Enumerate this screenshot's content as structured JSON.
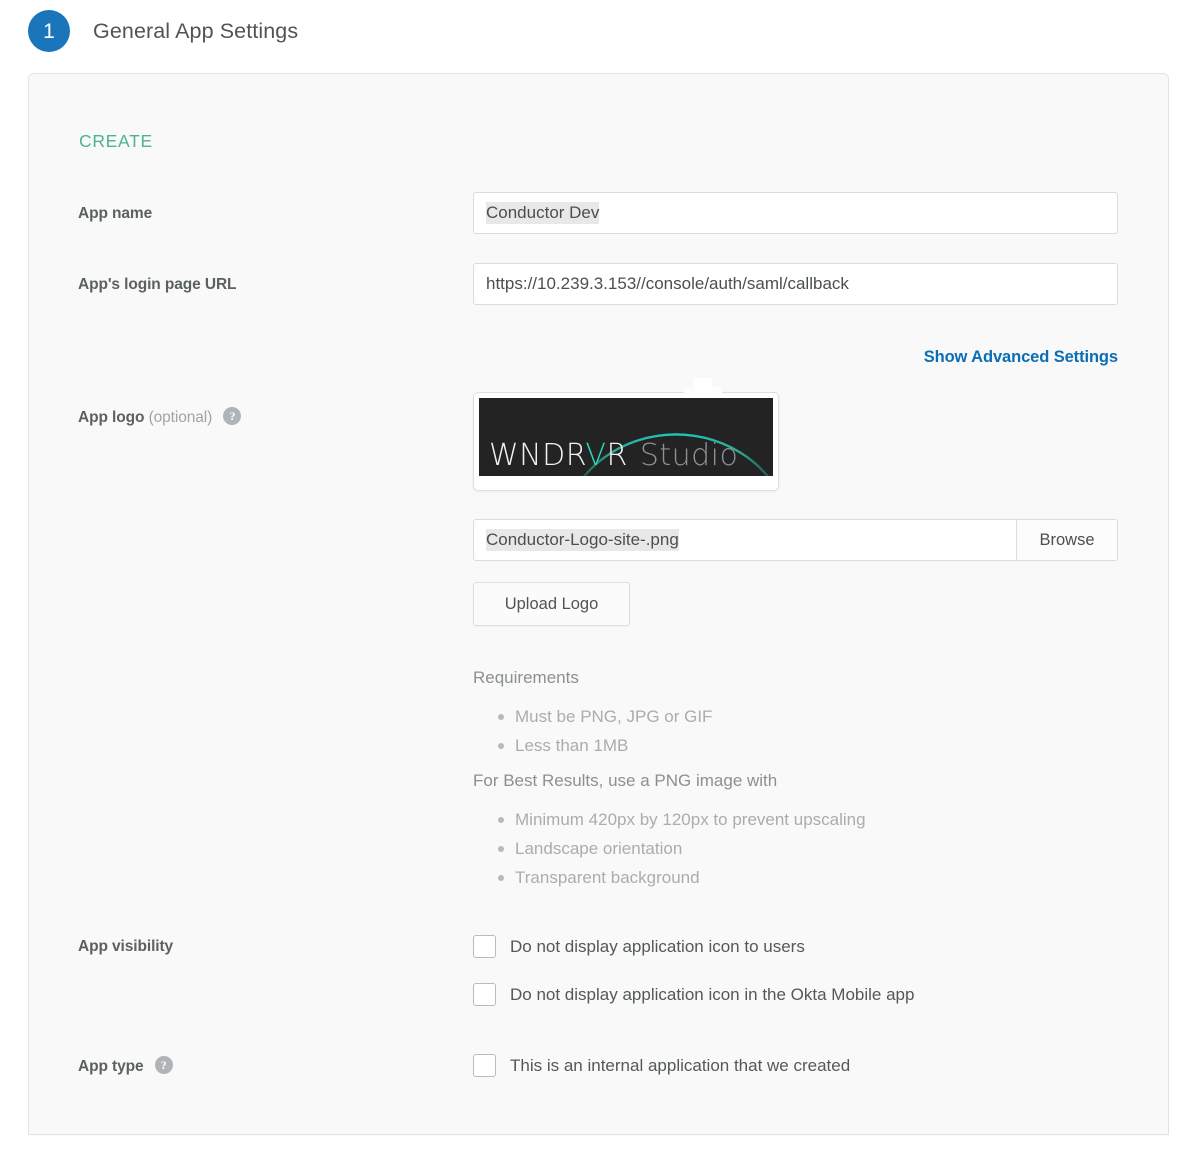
{
  "step": {
    "number": "1",
    "title": "General App Settings",
    "badge_color": "#1a75bb"
  },
  "panel": {
    "section_label": "CREATE",
    "section_label_color": "#4cb58c"
  },
  "fields": {
    "app_name": {
      "label": "App name",
      "value": "Conductor Dev"
    },
    "login_url": {
      "label": "App's login page URL",
      "value": "https://10.239.3.153//console/auth/saml/callback"
    },
    "advanced_link": {
      "label": "Show Advanced Settings",
      "color": "#0a6db5"
    },
    "app_logo": {
      "label": "App logo",
      "optional_text": "(optional)",
      "help_glyph": "?",
      "preview_alt": "WNDRVR Studio logo",
      "logo_text_primary": "WNDR",
      "logo_text_accent": "V",
      "logo_text_primary_tail": "R",
      "logo_text_secondary": "Studio",
      "logo_bg_color": "#232323",
      "logo_accent_color": "#2fd6c0",
      "file_name": "Conductor-Logo-site-.png",
      "browse_label": "Browse",
      "upload_label": "Upload Logo"
    },
    "app_visibility": {
      "label": "App visibility",
      "checkboxes": [
        {
          "label": "Do not display application icon to users",
          "checked": false
        },
        {
          "label": "Do not display application icon in the Okta Mobile app",
          "checked": false
        }
      ]
    },
    "app_type": {
      "label": "App type",
      "help_glyph": "?",
      "checkboxes": [
        {
          "label": "This is an internal application that we created",
          "checked": false
        }
      ]
    }
  },
  "requirements": {
    "heading": "Requirements",
    "items": [
      "Must be PNG, JPG or GIF",
      "Less than 1MB"
    ],
    "best_results_heading": "For Best Results, use a PNG image with",
    "best_results_items": [
      "Minimum 420px by 120px to prevent upscaling",
      "Landscape orientation",
      "Transparent background"
    ]
  }
}
